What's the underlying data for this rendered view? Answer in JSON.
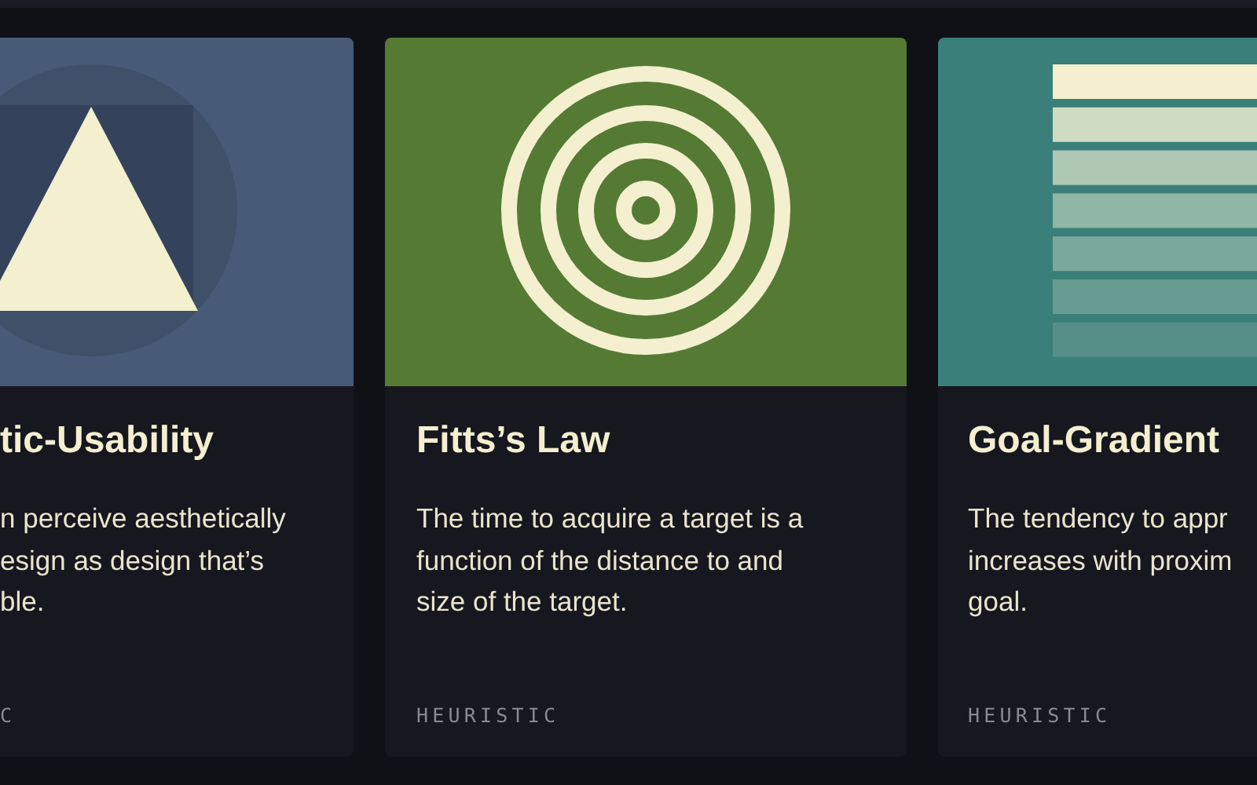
{
  "cards": [
    {
      "kind": "triangle",
      "title": "tic-Usability",
      "lines": [
        "n perceive aesthetically",
        "esign as design that’s",
        "ble."
      ],
      "label": "C"
    },
    {
      "kind": "target",
      "title": "Fitts’s Law",
      "lines": [
        "The time to acquire a target is a",
        "function of the distance to and",
        "size of the target."
      ],
      "label": "HEURISTIC"
    },
    {
      "kind": "bars",
      "title": "Goal-Gradient",
      "lines": [
        "The tendency to appr",
        "increases with proxim",
        "goal."
      ],
      "label": "HEURISTIC"
    }
  ]
}
